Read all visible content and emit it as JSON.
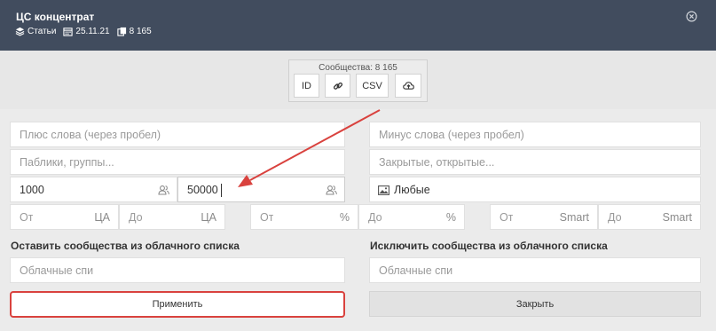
{
  "header": {
    "title": "ЦС концентрат",
    "type_label": "Статьи",
    "date": "25.11.21",
    "count": "8 165"
  },
  "export": {
    "count_label": "Сообщества: 8 165",
    "id_label": "ID",
    "csv_label": "CSV"
  },
  "filters": {
    "plus_words_placeholder": "Плюс слова (через пробел)",
    "minus_words_placeholder": "Минус слова (через пробел)",
    "publics_placeholder": "Паблики, группы...",
    "closed_open_placeholder": "Закрытые, открытые...",
    "min_members_value": "1000",
    "max_members_value": "50000",
    "photo_label": "Любые",
    "ca_from_placeholder": "От",
    "ca_from_suffix": "ЦА",
    "ca_to_placeholder": "До",
    "ca_to_suffix": "ЦА",
    "pct_from_placeholder": "От",
    "pct_from_suffix": "%",
    "pct_to_placeholder": "До",
    "pct_to_suffix": "%",
    "smart_from_placeholder": "От",
    "smart_from_suffix": "Smart",
    "smart_to_placeholder": "До",
    "smart_to_suffix": "Smart"
  },
  "cloud": {
    "keep_label": "Оставить сообщества из облачного списка",
    "exclude_label": "Исключить сообщества из облачного списка",
    "keep_placeholder": "Облачные спи",
    "exclude_placeholder": "Облачные спи"
  },
  "actions": {
    "apply_label": "Применить",
    "close_label": "Закрыть"
  },
  "colors": {
    "header_bg": "#414c5e",
    "highlight": "#d9423e"
  }
}
